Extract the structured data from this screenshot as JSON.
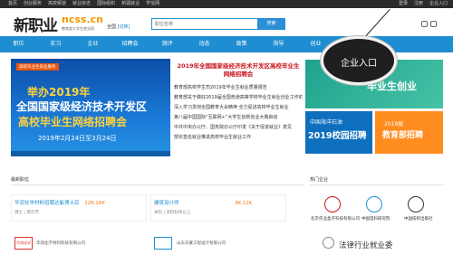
{
  "topbar": {
    "links": [
      "首页",
      "创业服务",
      "高校频道",
      "就业杂志",
      "国际组织",
      "新疆就业",
      "学信网"
    ],
    "right": [
      "登录",
      "注册",
      "企业入口"
    ]
  },
  "header": {
    "logo_cn": "新职业",
    "logo_en": "ncss.cn",
    "logo_sub": "教育部大学生就业网",
    "region_label": "全国",
    "region_switch": "[切换]",
    "search_placeholder": "职位名称",
    "search_button": "搜索"
  },
  "nav": [
    "职位",
    "实习",
    "企业",
    "招聘会",
    "测评",
    "动态",
    "政策",
    "指导",
    "创业"
  ],
  "banner": {
    "tag": "高校毕业生就业服务",
    "line1": "举办2019年",
    "line2": "全国国家级经济技术开发区",
    "line3": "高校毕业生网络招聘会",
    "dates": "2019年2月24日至3月24日"
  },
  "news": {
    "headline": "2019年全国国家级经济技术开发区高校毕业生网络招聘会",
    "items": [
      "教育部高校学生司2019年毕业生就业质量报告",
      "教育部关于做好2019届全国普通高等学校毕业生就业创业工作的通知",
      "深入学习贯彻全国教育大会精神 全力促进高校毕业生就业",
      "第八届中国国际“互联网+”大学生创新创业大赛启动",
      "中共中央办公厅、国务院办公厅印发《关于促进就业》意见",
      "部长签名就业推进高校毕业生就业工作"
    ]
  },
  "promos": {
    "p1": "毕业生创业",
    "p2_small": "中国海洋石油",
    "p2_big": "2019校园招聘",
    "p3_small": "2019届",
    "p3_big": "教育部招聘"
  },
  "enterprise_entry": "企业入口",
  "sections": {
    "latest_jobs": "最新职位",
    "hot_companies": "热门企业"
  },
  "jobs": [
    {
      "name": "华润化学材料招聘达能博士后",
      "salary": "12K-16K",
      "meta": "博士 | 南京市"
    },
    {
      "name": "建筑设计师",
      "salary": "4K-12K",
      "meta": "本科 | 资料科目以上"
    }
  ],
  "companies": [
    {
      "name": "华润化学材料科技有限公司",
      "logo": "华润化学"
    },
    {
      "name": "山东天蒙工程设计有限公司",
      "logo": ""
    }
  ],
  "hot": [
    {
      "name": "北京作业盒子科技有限公司"
    },
    {
      "name": "中国电科研究院"
    },
    {
      "name": "中国纺织出版社"
    }
  ],
  "watermark": "法律行业就业委"
}
